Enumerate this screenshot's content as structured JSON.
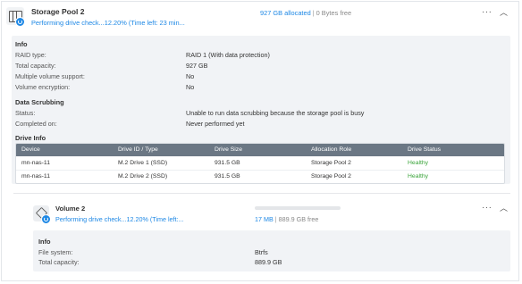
{
  "pool": {
    "name": "Storage Pool 2",
    "progress_text": "Performing drive check...12.20% (Time left: 23 min...",
    "allocated": "927 GB allocated",
    "separator": "|",
    "free": "0 Bytes free",
    "more_icon": "more-horizontal-icon",
    "collapse_icon": "chevron-up-icon",
    "info": {
      "title": "Info",
      "rows": [
        {
          "label": "RAID type:",
          "value": "RAID 1 (With data protection)"
        },
        {
          "label": "Total capacity:",
          "value": "927 GB"
        },
        {
          "label": "Multiple volume support:",
          "value": "No"
        },
        {
          "label": "Volume encryption:",
          "value": "No"
        }
      ]
    },
    "scrubbing": {
      "title": "Data Scrubbing",
      "rows": [
        {
          "label": "Status:",
          "value": "Unable to run data scrubbing because the storage pool is busy"
        },
        {
          "label": "Completed on:",
          "value": "Never performed yet"
        }
      ]
    },
    "drive_info": {
      "title": "Drive Info",
      "columns": [
        "Device",
        "Drive ID / Type",
        "Drive Size",
        "Allocation Role",
        "Drive Status"
      ],
      "rows": [
        [
          "mn-nas-11",
          "M.2 Drive 1 (SSD)",
          "931.5 GB",
          "Storage Pool 2",
          "Healthy"
        ],
        [
          "mn-nas-11",
          "M.2 Drive 2 (SSD)",
          "931.5 GB",
          "Storage Pool 2",
          "Healthy"
        ]
      ],
      "healthy_color": "#3aa43a"
    }
  },
  "volume": {
    "name": "Volume 2",
    "progress_text": "Performing drive check...12.20% (Time left:...",
    "used": "17 MB",
    "separator": "|",
    "free": "889.9 GB free",
    "usage_fraction": 0.0001,
    "info": {
      "title": "Info",
      "rows": [
        {
          "label": "File system:",
          "value": "Btrfs"
        },
        {
          "label": "Total capacity:",
          "value": "889.9 GB"
        }
      ]
    }
  },
  "colors": {
    "accent": "#1e88e5",
    "panel_bg": "#f1f3f6",
    "table_header_bg": "#6b7784"
  }
}
